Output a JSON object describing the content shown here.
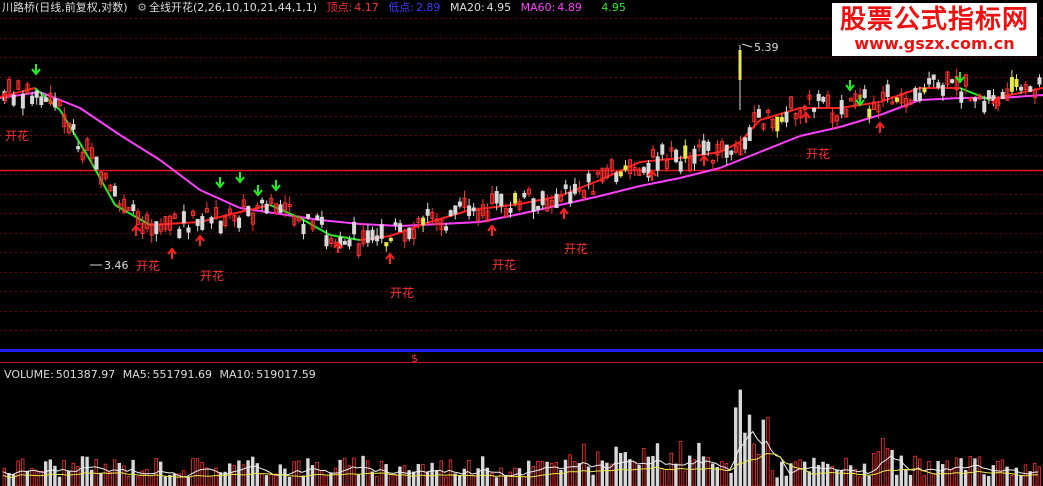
{
  "header": {
    "stock_name": "川路桥",
    "period_info": "(日线,前复权,对数)",
    "indicator_name": "全线开花",
    "indicator_params": "(2,26,10,10,21,44,1,1)",
    "top_label": "顶点:",
    "top_value": "4.17",
    "low_label": "低点:",
    "low_value": "2.89",
    "ma20_label": "MA20:",
    "ma20_value": "4.95",
    "ma60_label": "MA60:",
    "ma60_value": "4.89",
    "extra_value": "4.95"
  },
  "watermark": {
    "title": "股票公式指标网",
    "url": "www.gszx.com.cn"
  },
  "chart_labels": {
    "bloom_label": "开花",
    "low_price": "3.46",
    "high_price": "5.39",
    "divider_mark": "$"
  },
  "volume_header": {
    "volume_label": "VOLUME:",
    "volume_value": "501387.97",
    "ma5_label": "MA5:",
    "ma5_value": "551791.69",
    "ma10_label": "MA10:",
    "ma10_value": "519017.59"
  },
  "colors": {
    "up": "#ff3030",
    "down": "#d8d8d8",
    "ma20": "#ff2020",
    "ma60": "#ff40ff",
    "arrow_down": "#22ee22",
    "arrow_up": "#ff2020",
    "grid": "#6a0000",
    "divider_blue": "#1c1cff"
  }
}
